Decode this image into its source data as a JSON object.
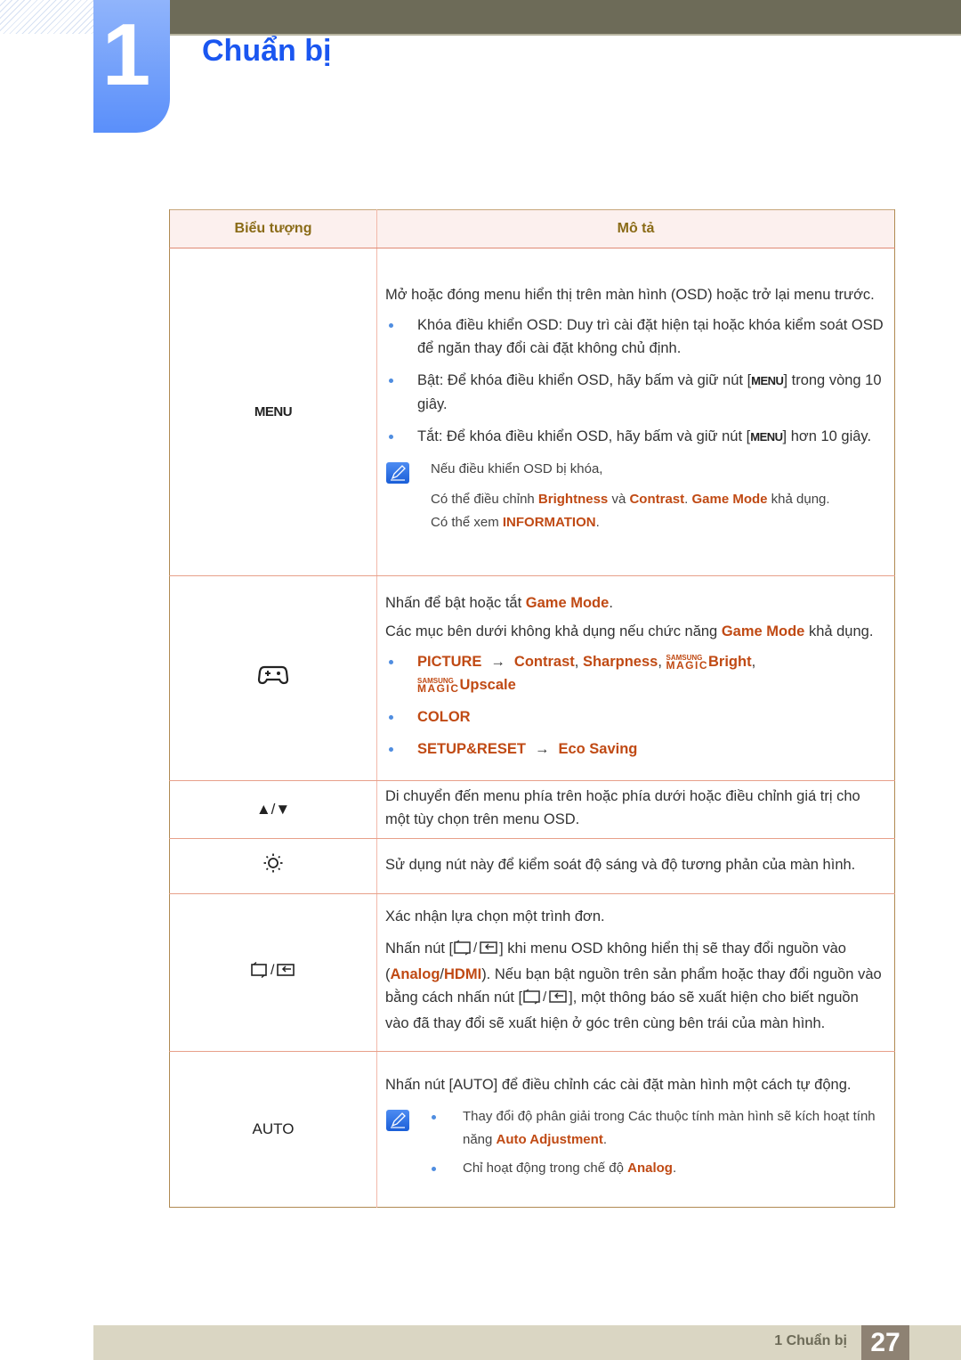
{
  "chapter": {
    "number": "1",
    "title": "Chuẩn bị"
  },
  "table": {
    "headers": {
      "icon": "Biểu tượng",
      "description": "Mô tả"
    },
    "rows": {
      "menu": {
        "icon_label": "MENU",
        "intro": "Mở hoặc đóng menu hiển thị trên màn hình (OSD) hoặc trở lại menu trước.",
        "bullets": [
          {
            "text": "Khóa điều khiển OSD: Duy trì cài đặt hiện tại hoặc khóa kiểm soát OSD để ngăn thay đổi cài đặt không chủ định."
          },
          {
            "pre": "Bật: Để khóa điều khiển OSD, hãy bấm và giữ nút [",
            "key": "MENU",
            "post": "] trong vòng 10 giây."
          },
          {
            "pre": "Tắt: Để khóa điều khiển OSD, hãy bấm và giữ nút [",
            "key": "MENU",
            "post": "] hơn 10 giây."
          }
        ],
        "note": {
          "line1": "Nếu điều khiển OSD bị khóa,",
          "l2_a": "Có thể điều chỉnh ",
          "l2_b": "Brightness",
          "l2_c": " và ",
          "l2_d": "Contrast",
          "l2_e": ". ",
          "l2_f": "Game Mode",
          "l2_g": " khả dụng.",
          "l3_a": "Có thể xem ",
          "l3_b": "INFORMATION",
          "l3_c": "."
        }
      },
      "game": {
        "icon_name": "gamepad-icon",
        "p1_a": "Nhấn để bật hoặc tắt ",
        "p1_b": "Game Mode",
        "p1_c": ".",
        "p2_a": "Các mục bên dưới không khả dụng nếu chức năng ",
        "p2_b": "Game Mode",
        "p2_c": " khả dụng.",
        "bullet1": {
          "menu": "PICTURE",
          "arrow": "→",
          "items": [
            "Contrast",
            "Sharpness"
          ],
          "magic_top": "SAMSUNG",
          "magic_bottom": "MAGIC",
          "bright": "Bright",
          "upscale": "Upscale",
          "sep": ", "
        },
        "bullet2": {
          "menu": "COLOR"
        },
        "bullet3": {
          "menu": "SETUP&RESET",
          "arrow": "→",
          "item": "Eco Saving"
        }
      },
      "updown": {
        "icon_label": "▲/▼",
        "text": "Di chuyển đến menu phía trên hoặc phía dưới hoặc điều chỉnh giá trị cho một tùy chọn trên menu OSD."
      },
      "brightness": {
        "icon_name": "brightness-sun-icon",
        "text": "Sử dụng nút này để kiểm soát độ sáng và độ tương phản của màn hình."
      },
      "source": {
        "icon_sep": "/",
        "p1": "Xác nhận lựa chọn một trình đơn.",
        "p2_a": "Nhấn nút [",
        "p2_b": "] khi menu OSD không hiển thị sẽ thay đổi nguồn vào (",
        "p2_c": "Analog",
        "p2_d": "/",
        "p2_e": "HDMI",
        "p2_f": "). Nếu bạn bật nguồn trên sản phẩm hoặc thay đổi nguồn vào bằng cách nhấn nút [",
        "p2_g": "], một thông báo sẽ xuất hiện cho biết nguồn vào đã thay đổi sẽ xuất hiện ở góc trên cùng bên trái của màn hình."
      },
      "auto": {
        "icon_label": "AUTO",
        "p1": "Nhấn nút [AUTO] để điều chỉnh các cài đặt màn hình một cách tự động.",
        "note_b1_a": "Thay đổi độ phân giải trong Các thuộc tính màn hình sẽ kích hoạt tính năng ",
        "note_b1_b": "Auto Adjustment",
        "note_b1_c": ".",
        "note_b2_a": "Chỉ hoạt động trong chế độ ",
        "note_b2_b": "Analog",
        "note_b2_c": "."
      }
    }
  },
  "footer": {
    "section": "1 Chuẩn bị",
    "page": "27"
  }
}
